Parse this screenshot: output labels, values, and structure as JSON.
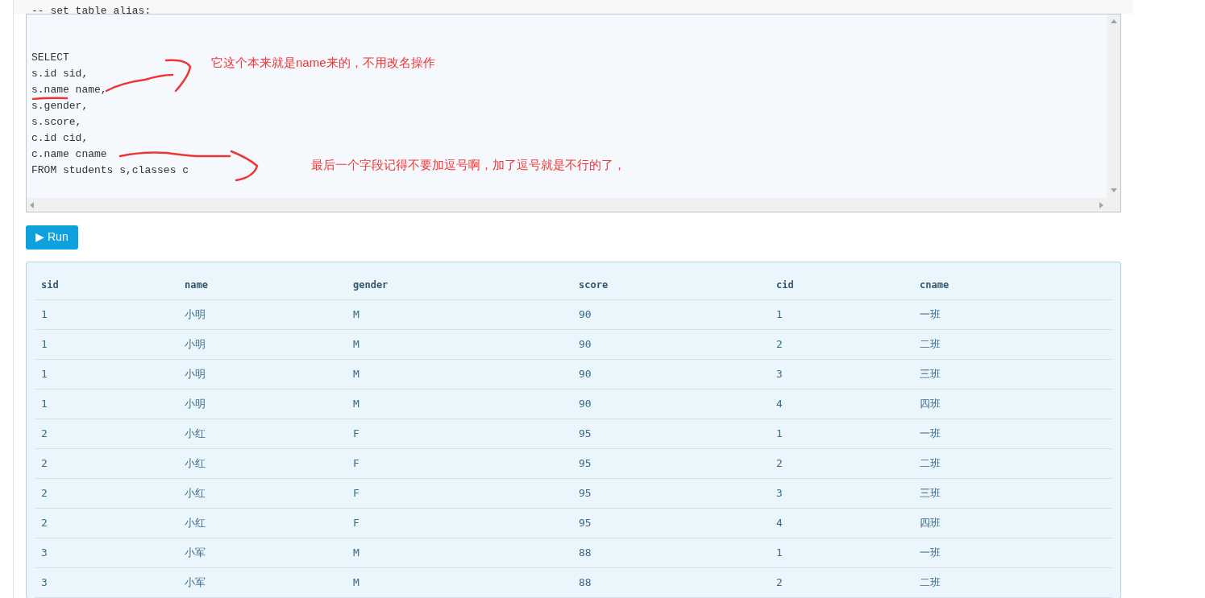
{
  "comment_line": "-- set table alias:",
  "code_lines": [
    "SELECT",
    "s.id sid,",
    "s.name name,",
    "s.gender,",
    "s.score,",
    "c.id cid,",
    "c.name cname",
    "FROM students s,classes c"
  ],
  "annotations": [
    "它这个本来就是name来的，不用改名操作",
    "最后一个字段记得不要加逗号啊，加了逗号就是不行的了，"
  ],
  "run_button": {
    "icon": "▶",
    "label": "Run"
  },
  "table": {
    "columns": [
      "sid",
      "name",
      "gender",
      "score",
      "cid",
      "cname"
    ],
    "rows": [
      [
        "1",
        "小明",
        "M",
        "90",
        "1",
        "一班"
      ],
      [
        "1",
        "小明",
        "M",
        "90",
        "2",
        "二班"
      ],
      [
        "1",
        "小明",
        "M",
        "90",
        "3",
        "三班"
      ],
      [
        "1",
        "小明",
        "M",
        "90",
        "4",
        "四班"
      ],
      [
        "2",
        "小红",
        "F",
        "95",
        "1",
        "一班"
      ],
      [
        "2",
        "小红",
        "F",
        "95",
        "2",
        "二班"
      ],
      [
        "2",
        "小红",
        "F",
        "95",
        "3",
        "三班"
      ],
      [
        "2",
        "小红",
        "F",
        "95",
        "4",
        "四班"
      ],
      [
        "3",
        "小军",
        "M",
        "88",
        "1",
        "一班"
      ],
      [
        "3",
        "小军",
        "M",
        "88",
        "2",
        "二班"
      ]
    ]
  }
}
